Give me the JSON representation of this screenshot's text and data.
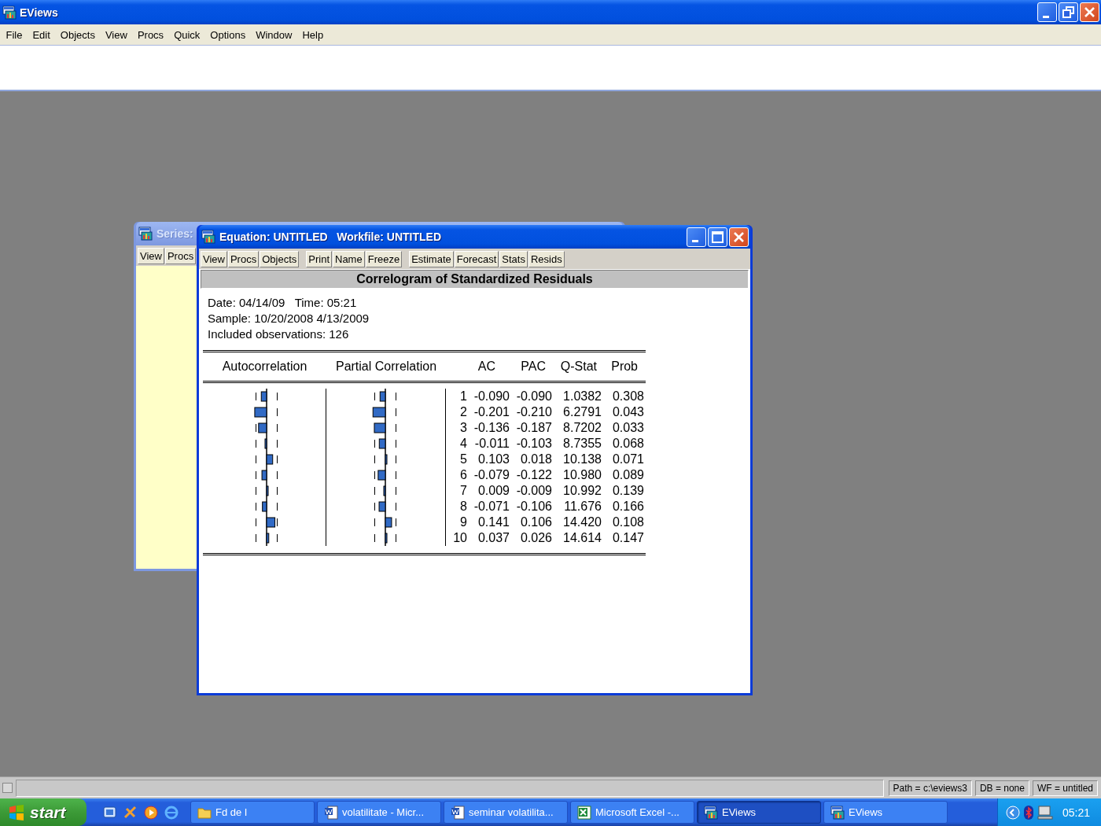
{
  "app": {
    "title": "EViews",
    "menu": [
      "File",
      "Edit",
      "Objects",
      "View",
      "Procs",
      "Quick",
      "Options",
      "Window",
      "Help"
    ]
  },
  "series_window": {
    "title": "Series:",
    "active": false,
    "toolbar_groups": [
      [
        "View",
        "Procs"
      ]
    ]
  },
  "equation_window": {
    "title": "Equation: UNTITLED   Workfile: UNTITLED",
    "active": true,
    "toolbar_groups": [
      [
        "View",
        "Procs",
        "Objects"
      ],
      [
        "Print",
        "Name",
        "Freeze"
      ],
      [
        "Estimate",
        "Forecast",
        "Stats",
        "Resids"
      ]
    ],
    "output": {
      "heading": "Correlogram of Standardized Residuals",
      "info": [
        "Date: 04/14/09   Time: 05:21",
        "Sample: 10/20/2008 4/13/2009",
        "Included observations: 126"
      ],
      "columns": [
        "Autocorrelation",
        "Partial Correlation",
        "AC",
        "PAC",
        "Q-Stat",
        "Prob"
      ],
      "rows": [
        {
          "lag": "1",
          "ac": "-0.090",
          "pac": "-0.090",
          "q_stat": "1.0382",
          "prob": "0.308"
        },
        {
          "lag": "2",
          "ac": "-0.201",
          "pac": "-0.210",
          "q_stat": "6.2791",
          "prob": "0.043"
        },
        {
          "lag": "3",
          "ac": "-0.136",
          "pac": "-0.187",
          "q_stat": "8.7202",
          "prob": "0.033"
        },
        {
          "lag": "4",
          "ac": "-0.011",
          "pac": "-0.103",
          "q_stat": "8.7355",
          "prob": "0.068"
        },
        {
          "lag": "5",
          "ac": "0.103",
          "pac": "0.018",
          "q_stat": "10.138",
          "prob": "0.071"
        },
        {
          "lag": "6",
          "ac": "-0.079",
          "pac": "-0.122",
          "q_stat": "10.980",
          "prob": "0.089"
        },
        {
          "lag": "7",
          "ac": "0.009",
          "pac": "-0.009",
          "q_stat": "10.992",
          "prob": "0.139"
        },
        {
          "lag": "8",
          "ac": "-0.071",
          "pac": "-0.106",
          "q_stat": "11.676",
          "prob": "0.166"
        },
        {
          "lag": "9",
          "ac": "0.141",
          "pac": "0.106",
          "q_stat": "14.420",
          "prob": "0.108"
        },
        {
          "lag": "10",
          "ac": "0.037",
          "pac": "0.026",
          "q_stat": "14.614",
          "prob": "0.147"
        }
      ]
    }
  },
  "status_bar": {
    "fields": [
      "Path = c:\\eviews3",
      "DB = none",
      "WF = untitled"
    ]
  },
  "taskbar": {
    "start": "start",
    "tasks": [
      {
        "label": "Fd de I",
        "kind": "folder",
        "selected": false
      },
      {
        "label": "volatilitate - Micr...",
        "kind": "document",
        "selected": false
      },
      {
        "label": "seminar volatilita...",
        "kind": "document",
        "selected": false
      },
      {
        "label": "Microsoft Excel -...",
        "kind": "spreadsheet",
        "selected": false
      },
      {
        "label": "EViews",
        "kind": "program",
        "selected": true
      },
      {
        "label": "EViews",
        "kind": "program",
        "selected": false
      }
    ],
    "clock": "05:21"
  }
}
